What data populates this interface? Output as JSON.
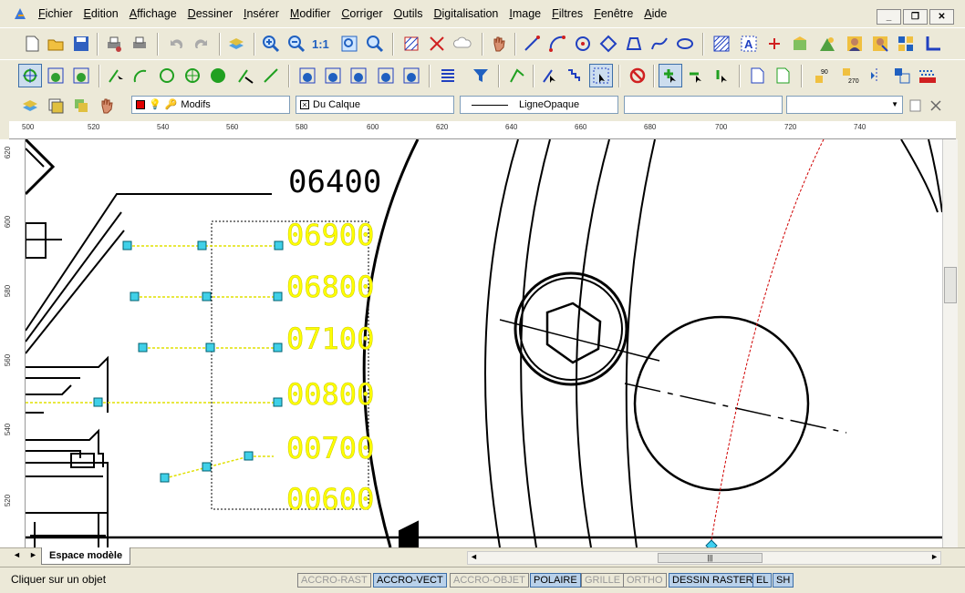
{
  "menu": [
    "Fichier",
    "Edition",
    "Affichage",
    "Dessiner",
    "Insérer",
    "Modifier",
    "Corriger",
    "Outils",
    "Digitalisation",
    "Image",
    "Filtres",
    "Fenêtre",
    "Aide"
  ],
  "window_buttons": {
    "minimize": "_",
    "restore": "❐",
    "close": "✕"
  },
  "props": {
    "layer": "Modifs",
    "color": "Du Calque",
    "linetype": "LigneOpaque",
    "field4": "",
    "field5": ""
  },
  "ruler_top": [
    "500",
    "520",
    "540",
    "560",
    "580",
    "600",
    "620",
    "640",
    "660",
    "680",
    "700",
    "720",
    "740"
  ],
  "ruler_left": [
    "620",
    "600",
    "580",
    "560",
    "540",
    "520"
  ],
  "drawing": {
    "label_black": "06400",
    "labels_yellow": [
      "06900",
      "06800",
      "07100",
      "00800",
      "00700",
      "00600"
    ]
  },
  "tab_label": "Espace modèle",
  "status": {
    "message": "Cliquer sur un objet",
    "buttons": [
      {
        "label": "ACCRO-RAST",
        "on": false
      },
      {
        "label": "ACCRO-VECT",
        "on": true
      },
      {
        "label": "ACCRO-OBJET",
        "on": false
      },
      {
        "label": "POLAIRE",
        "on": true
      },
      {
        "label": "GRILLE",
        "on": false
      },
      {
        "label": "ORTHO",
        "on": false
      },
      {
        "label": "DESSIN RASTER",
        "on": true
      },
      {
        "label": "EL",
        "on": true
      },
      {
        "label": "SH",
        "on": true
      }
    ]
  },
  "colors": {
    "accent": "#3c6ea8",
    "yellow": "#ffff00",
    "handle": "#00d0e0"
  }
}
